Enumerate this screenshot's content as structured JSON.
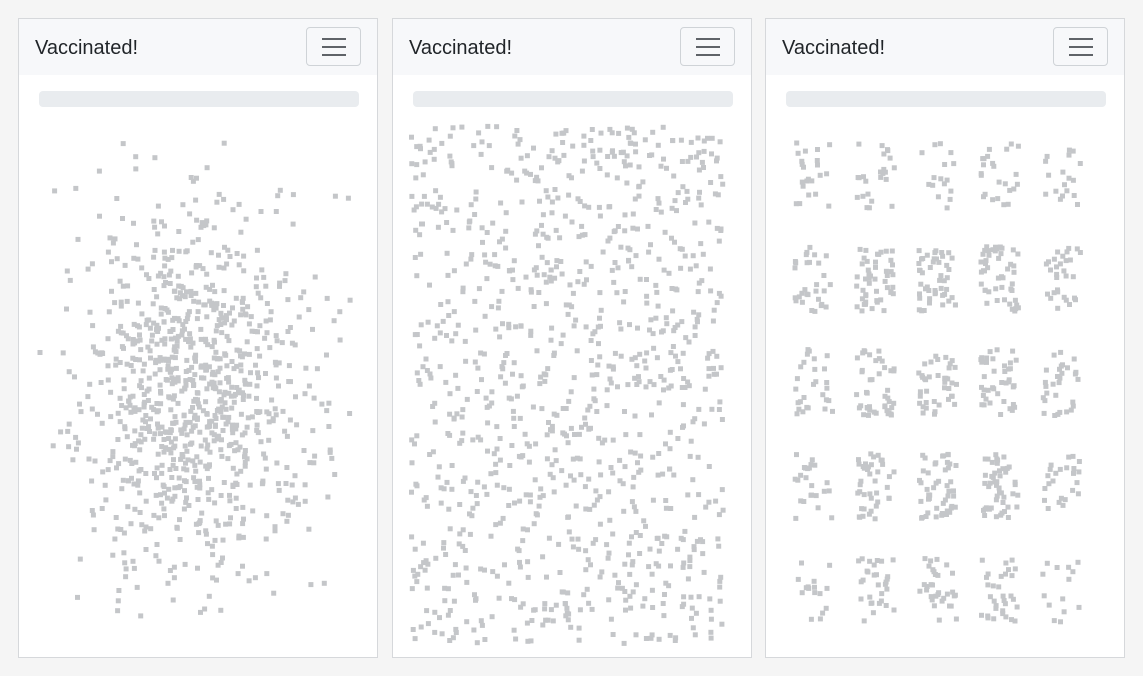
{
  "panels": [
    {
      "brand": "Vaccinated!",
      "progress": 0,
      "dot_color": "#c4c6c9",
      "layout": "gaussian-cluster"
    },
    {
      "brand": "Vaccinated!",
      "progress": 0,
      "dot_color": "#c4c6c9",
      "layout": "uniform-spread"
    },
    {
      "brand": "Vaccinated!",
      "progress": 0,
      "dot_color": "#c4c6c9",
      "layout": "5x5-grid-clusters"
    }
  ],
  "icons": {
    "menu": "hamburger-menu-icon"
  }
}
